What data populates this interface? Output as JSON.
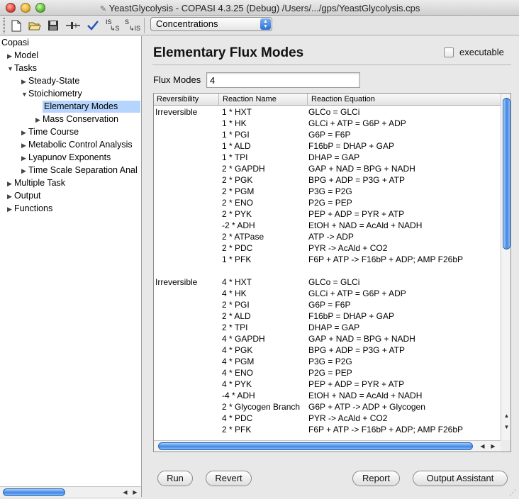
{
  "window": {
    "title": "YeastGlycolysis - COPASI 4.3.25 (Debug) /Users/.../gps/YeastGlycolysis.cps"
  },
  "toolbar": {
    "buttons": [
      {
        "name": "new-file-icon"
      },
      {
        "name": "open-folder-icon"
      },
      {
        "name": "save-disk-icon"
      },
      {
        "name": "slider-icon"
      },
      {
        "name": "check-icon"
      },
      {
        "name": "is-to-s-icon",
        "label_top": "IS",
        "label_bottom": "S"
      },
      {
        "name": "s-to-is-icon",
        "label_top": "S",
        "label_bottom": "IS"
      }
    ],
    "combo_value": "Concentrations"
  },
  "tree": {
    "root": "Copasi",
    "items": [
      {
        "label": "Model",
        "expanded": false
      },
      {
        "label": "Tasks",
        "expanded": true
      },
      {
        "label": "Steady-State",
        "expanded": false
      },
      {
        "label": "Stoichiometry",
        "expanded": true
      },
      {
        "label": "Elementary Modes",
        "selected": true
      },
      {
        "label": "Mass Conservation",
        "expanded": false
      },
      {
        "label": "Time Course",
        "expanded": false
      },
      {
        "label": "Metabolic Control Analysis",
        "expanded": false
      },
      {
        "label": "Lyapunov Exponents",
        "expanded": false
      },
      {
        "label": "Time Scale Separation Anal",
        "expanded": false
      },
      {
        "label": "Multiple Task",
        "expanded": false
      },
      {
        "label": "Output",
        "expanded": false
      },
      {
        "label": "Functions",
        "expanded": false
      }
    ]
  },
  "main": {
    "title": "Elementary Flux Modes",
    "executable_label": "executable",
    "executable_checked": false,
    "flux_modes_label": "Flux Modes",
    "flux_modes_value": "4",
    "columns": [
      "Reversibility",
      "Reaction Name",
      "Reaction Equation"
    ],
    "rows": [
      [
        "Irreversible",
        "1 * HXT",
        "GLCo = GLCi"
      ],
      [
        "",
        "1 * HK",
        "GLCi + ATP = G6P + ADP"
      ],
      [
        "",
        "1 * PGI",
        "G6P = F6P"
      ],
      [
        "",
        "1 * ALD",
        "F16bP = DHAP + GAP"
      ],
      [
        "",
        "1 * TPI",
        "DHAP = GAP"
      ],
      [
        "",
        "2 * GAPDH",
        "GAP + NAD = BPG + NADH"
      ],
      [
        "",
        "2 * PGK",
        "BPG + ADP = P3G + ATP"
      ],
      [
        "",
        "2 * PGM",
        "P3G = P2G"
      ],
      [
        "",
        "2 * ENO",
        "P2G = PEP"
      ],
      [
        "",
        "2 * PYK",
        "PEP + ADP = PYR + ATP"
      ],
      [
        "",
        "-2 * ADH",
        "EtOH + NAD = AcAld + NADH"
      ],
      [
        "",
        "2 * ATPase",
        "ATP -> ADP"
      ],
      [
        "",
        "2 * PDC",
        "PYR -> AcAld + CO2"
      ],
      [
        "",
        "1 * PFK",
        "F6P + ATP -> F16bP + ADP;  AMP F26bP"
      ],
      [
        "",
        "",
        ""
      ],
      [
        "Irreversible",
        "4 * HXT",
        "GLCo = GLCi"
      ],
      [
        "",
        "4 * HK",
        "GLCi + ATP = G6P + ADP"
      ],
      [
        "",
        "2 * PGI",
        "G6P = F6P"
      ],
      [
        "",
        "2 * ALD",
        "F16bP = DHAP + GAP"
      ],
      [
        "",
        "2 * TPI",
        "DHAP = GAP"
      ],
      [
        "",
        "4 * GAPDH",
        "GAP + NAD = BPG + NADH"
      ],
      [
        "",
        "4 * PGK",
        "BPG + ADP = P3G + ATP"
      ],
      [
        "",
        "4 * PGM",
        "P3G = P2G"
      ],
      [
        "",
        "4 * ENO",
        "P2G = PEP"
      ],
      [
        "",
        "4 * PYK",
        "PEP + ADP = PYR + ATP"
      ],
      [
        "",
        "-4 * ADH",
        "EtOH + NAD = AcAld + NADH"
      ],
      [
        "",
        "2 * Glycogen Branch",
        "G6P + ATP -> ADP + Glycogen"
      ],
      [
        "",
        "4 * PDC",
        "PYR -> AcAld + CO2"
      ],
      [
        "",
        "2 * PFK",
        "F6P + ATP -> F16bP + ADP;  AMP F26bP"
      ]
    ],
    "buttons": {
      "run": "Run",
      "revert": "Revert",
      "report": "Report",
      "output_assistant": "Output Assistant"
    }
  },
  "colors": {
    "selection": "#b5d5ff",
    "scroll_thumb": "#3f86e4"
  }
}
